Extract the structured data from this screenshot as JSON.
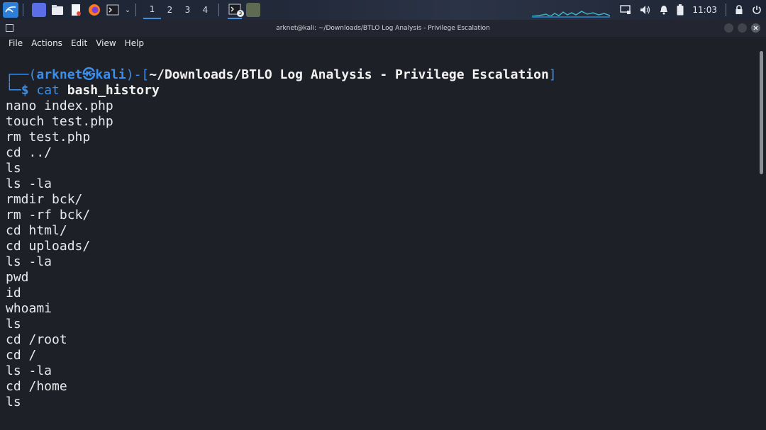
{
  "taskbar": {
    "workspaces": [
      "1",
      "2",
      "3",
      "4"
    ],
    "active_workspace_index": 0,
    "terminal_badge": "3",
    "clock": "11:03",
    "icons": [
      "kali-menu-icon",
      "show-desktop-icon",
      "file-manager-icon",
      "text-editor-icon",
      "firefox-icon",
      "terminal-icon",
      "chevron-down-icon",
      "terminal-task-icon",
      "image-task-icon",
      "network-graph",
      "display-icon",
      "volume-icon",
      "notification-bell-icon",
      "battery-icon",
      "lock-icon",
      "power-icon"
    ]
  },
  "window": {
    "title": "arknet@kali: ~/Downloads/BTLO Log Analysis - Privilege Escalation"
  },
  "menubar": {
    "items": [
      "File",
      "Actions",
      "Edit",
      "View",
      "Help"
    ]
  },
  "terminal": {
    "prompt": {
      "box_top_left": "┌──(",
      "user": "arknet",
      "at_symbol": "㉿",
      "host": "kali",
      "box_mid": ")-[",
      "path": "~/Downloads/BTLO Log Analysis - Privilege Escalation",
      "box_end": "]",
      "box_bottom_left": "└─",
      "dollar": "$",
      "command": "cat",
      "argument": "bash_history"
    },
    "output": [
      "nano index.php",
      "touch test.php",
      "rm test.php",
      "cd ../",
      "ls",
      "ls -la",
      "rmdir bck/",
      "rm -rf bck/",
      "cd html/",
      "cd uploads/",
      "ls -la",
      "pwd",
      "id",
      "whoami",
      "ls",
      "cd /root",
      "cd /",
      "ls -la",
      "cd /home",
      "ls"
    ]
  }
}
